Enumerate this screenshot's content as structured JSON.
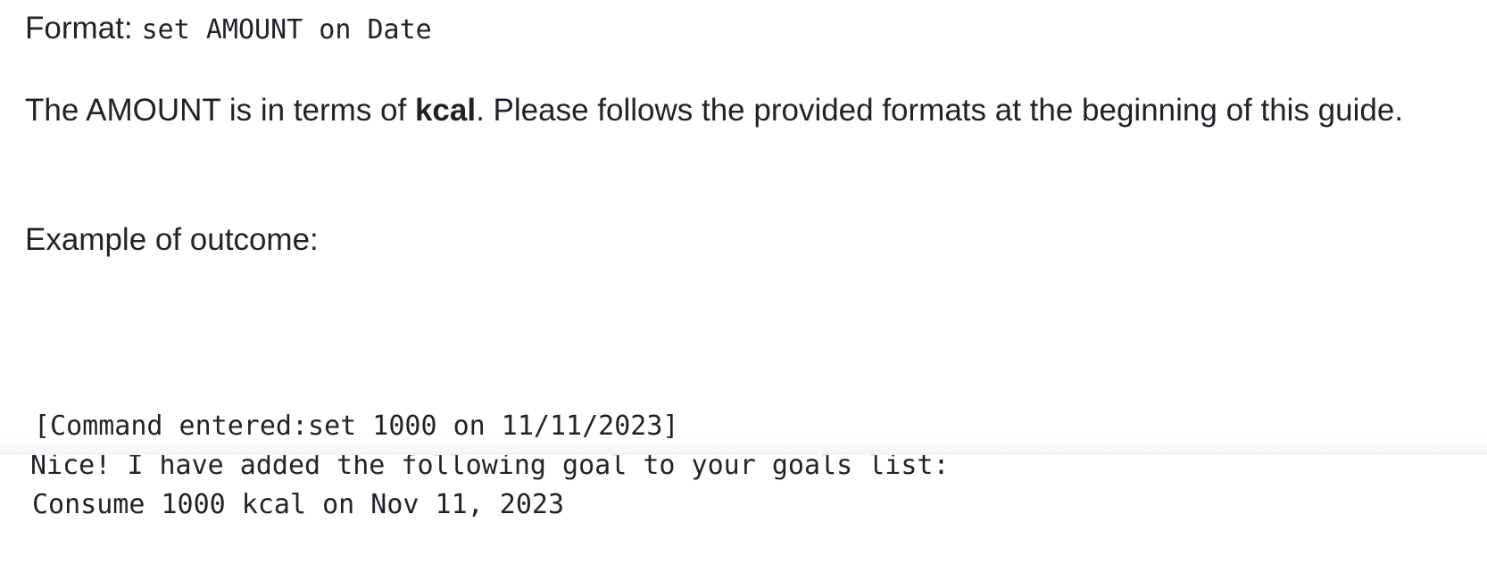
{
  "format": {
    "label": "Format:",
    "code": "set AMOUNT on Date"
  },
  "paragraph": {
    "before_bold": "The AMOUNT is in terms of ",
    "bold": "kcal",
    "after_bold": ". Please follows the provided formats at the beginning of this guide."
  },
  "example": {
    "label": "Example of outcome:",
    "lines": [
      "[Command entered:set 1000 on 11/11/2023]",
      "Nice! I have added the following goal to your goals list:",
      "Consume 1000 kcal on Nov 11, 2023"
    ]
  }
}
